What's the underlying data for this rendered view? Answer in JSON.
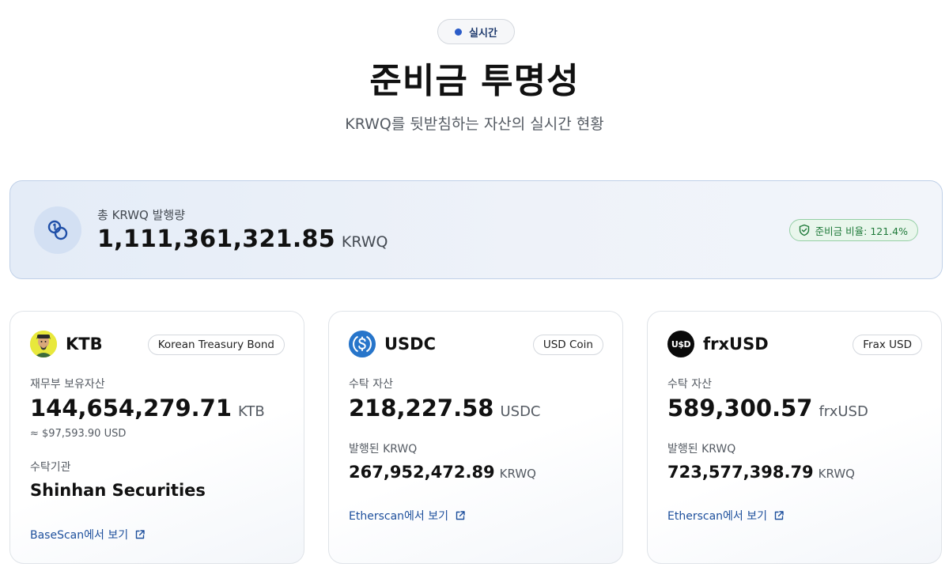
{
  "header": {
    "live_label": "실시간",
    "title": "준비금 투명성",
    "subtitle": "KRWQ를 뒷받침하는 자산의 실시간 현황"
  },
  "summary": {
    "label": "총 KRWQ 발행량",
    "amount": "1,111,361,321.85",
    "unit": "KRWQ",
    "ratio_label": "준비금 비율: 121.4%"
  },
  "assets": [
    {
      "symbol": "KTB",
      "tag": "Korean Treasury Bond",
      "holdings_label": "재무부 보유자산",
      "holdings_amount": "144,654,279.71",
      "holdings_unit": "KTB",
      "approx_usd": "≈ $97,593.90 USD",
      "custodian_label": "수탁기관",
      "custodian": "Shinhan Securities",
      "link_label": "BaseScan에서 보기"
    },
    {
      "symbol": "USDC",
      "tag": "USD Coin",
      "holdings_label": "수탁 자산",
      "holdings_amount": "218,227.58",
      "holdings_unit": "USDC",
      "issued_label": "발행된 KRWQ",
      "issued_amount": "267,952,472.89",
      "issued_unit": "KRWQ",
      "link_label": "Etherscan에서 보기"
    },
    {
      "symbol": "frxUSD",
      "logo_text": "U$D",
      "tag": "Frax USD",
      "holdings_label": "수탁 자산",
      "holdings_amount": "589,300.57",
      "holdings_unit": "frxUSD",
      "issued_label": "발행된 KRWQ",
      "issued_amount": "723,577,398.79",
      "issued_unit": "KRWQ",
      "link_label": "Etherscan에서 보기"
    }
  ],
  "colors": {
    "accent_blue": "#2b5cc8",
    "link_blue": "#1d4f9c",
    "ratio_green": "#1f7a3a",
    "usdc_blue": "#2775ca"
  },
  "icons": {
    "summary": "coins-icon",
    "ratio": "shield-check-icon",
    "link": "external-link-icon"
  }
}
